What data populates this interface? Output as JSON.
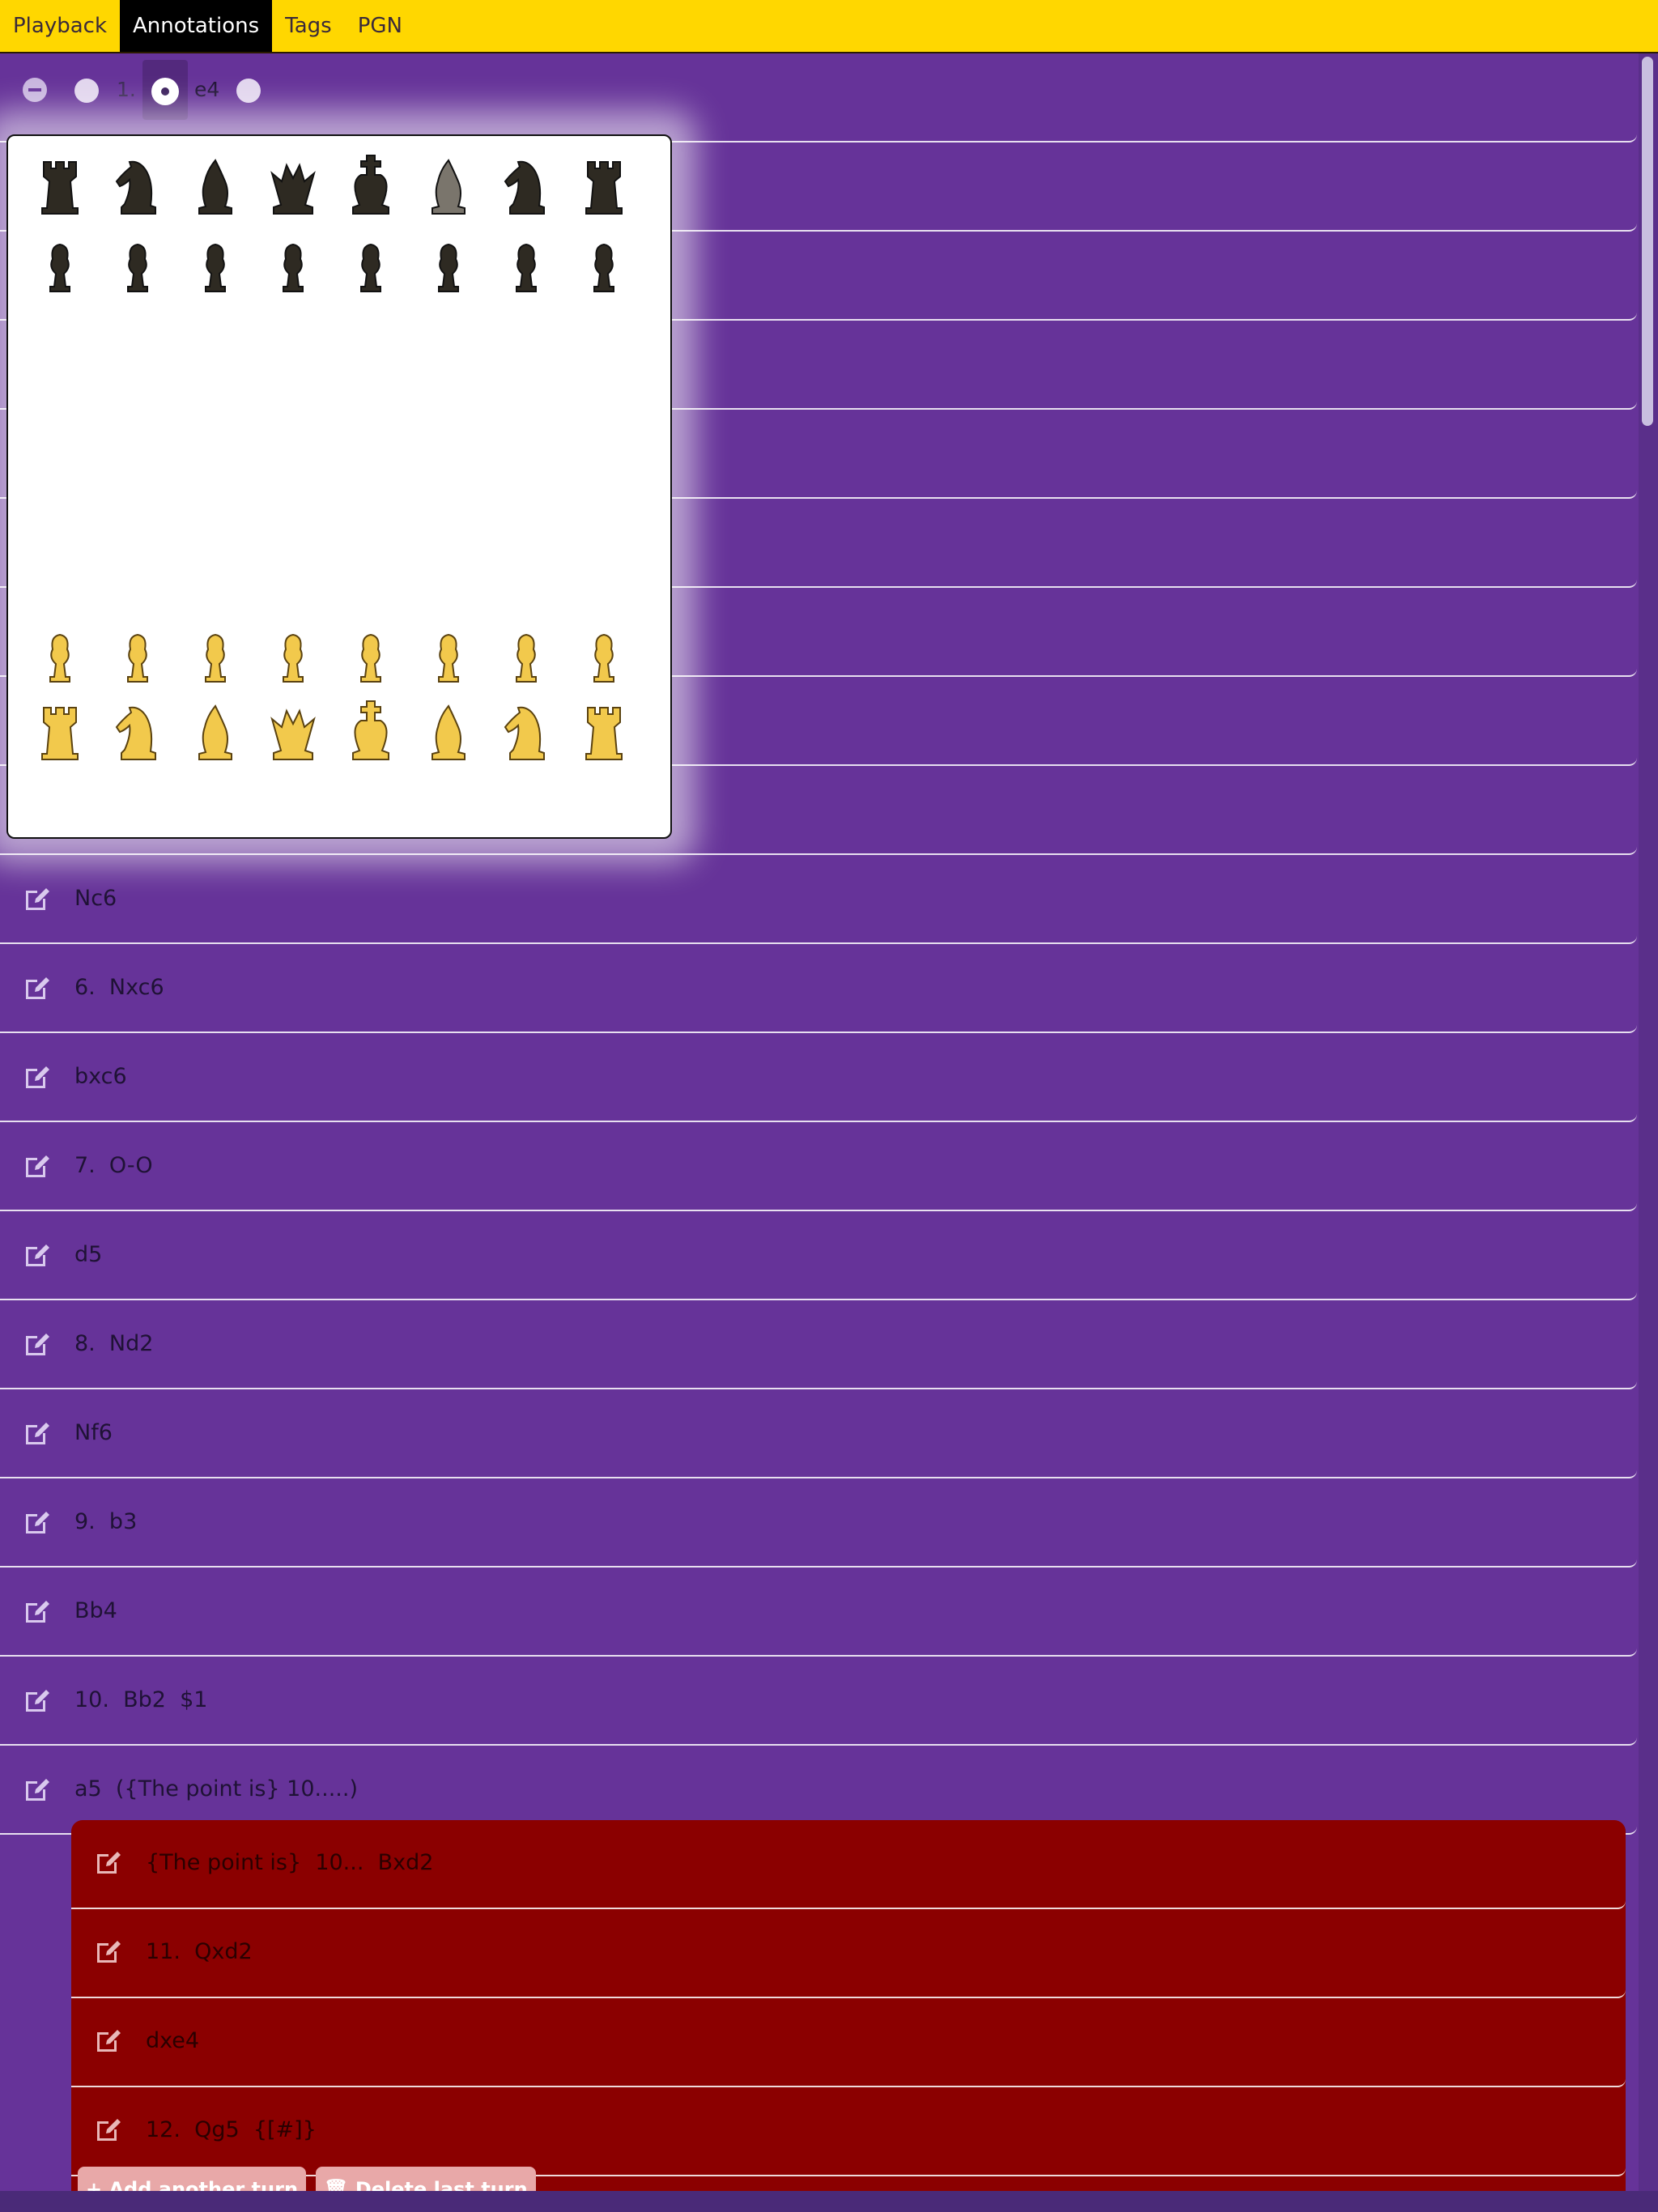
{
  "nav": {
    "tabs": [
      {
        "label": "Playback",
        "active": false
      },
      {
        "label": "Annotations",
        "active": true
      },
      {
        "label": "Tags",
        "active": false
      },
      {
        "label": "PGN",
        "active": false
      }
    ]
  },
  "first_turn": {
    "number": "1.",
    "move": "e4"
  },
  "rows": [
    {
      "label": ""
    },
    {
      "label": ""
    },
    {
      "label": ""
    },
    {
      "label": ""
    },
    {
      "label": ""
    },
    {
      "label": ""
    },
    {
      "label": ""
    },
    {
      "label": ""
    },
    {
      "label": ""
    },
    {
      "label": "Nc6"
    },
    {
      "label": "6.  Nxc6"
    },
    {
      "label": "bxc6"
    },
    {
      "label": "7.  O-O"
    },
    {
      "label": "d5"
    },
    {
      "label": "8.  Nd2"
    },
    {
      "label": "Nf6"
    },
    {
      "label": "9.  b3"
    },
    {
      "label": "Bb4"
    },
    {
      "label": "10.  Bb2  $1"
    },
    {
      "label": "a5  ({The point is} 10.....)"
    }
  ],
  "variation": {
    "rows": [
      {
        "label": "{The point is}  10...  Bxd2"
      },
      {
        "label": "11.  Qxd2"
      },
      {
        "label": "dxe4"
      },
      {
        "label": "12.  Qg5  {[#]}"
      }
    ],
    "add_label": "+ Add another turn",
    "delete_label": "🗑 Delete last turn"
  },
  "board": {
    "black_back_rank": [
      "rook",
      "knight",
      "bishop",
      "queen",
      "king",
      "bishop",
      "knight",
      "rook"
    ],
    "white_back_rank": [
      "rook",
      "knight",
      "bishop",
      "queen",
      "king",
      "bishop",
      "knight",
      "rook"
    ],
    "highlighted_piece": "black-f8-bishop",
    "colors": {
      "black": "#2e2a22",
      "white": "#f2c94c",
      "highlight": "#7a756c"
    }
  },
  "colors": {
    "nav": "#ffd700",
    "background": "#663399",
    "variation": "#8b0000"
  }
}
